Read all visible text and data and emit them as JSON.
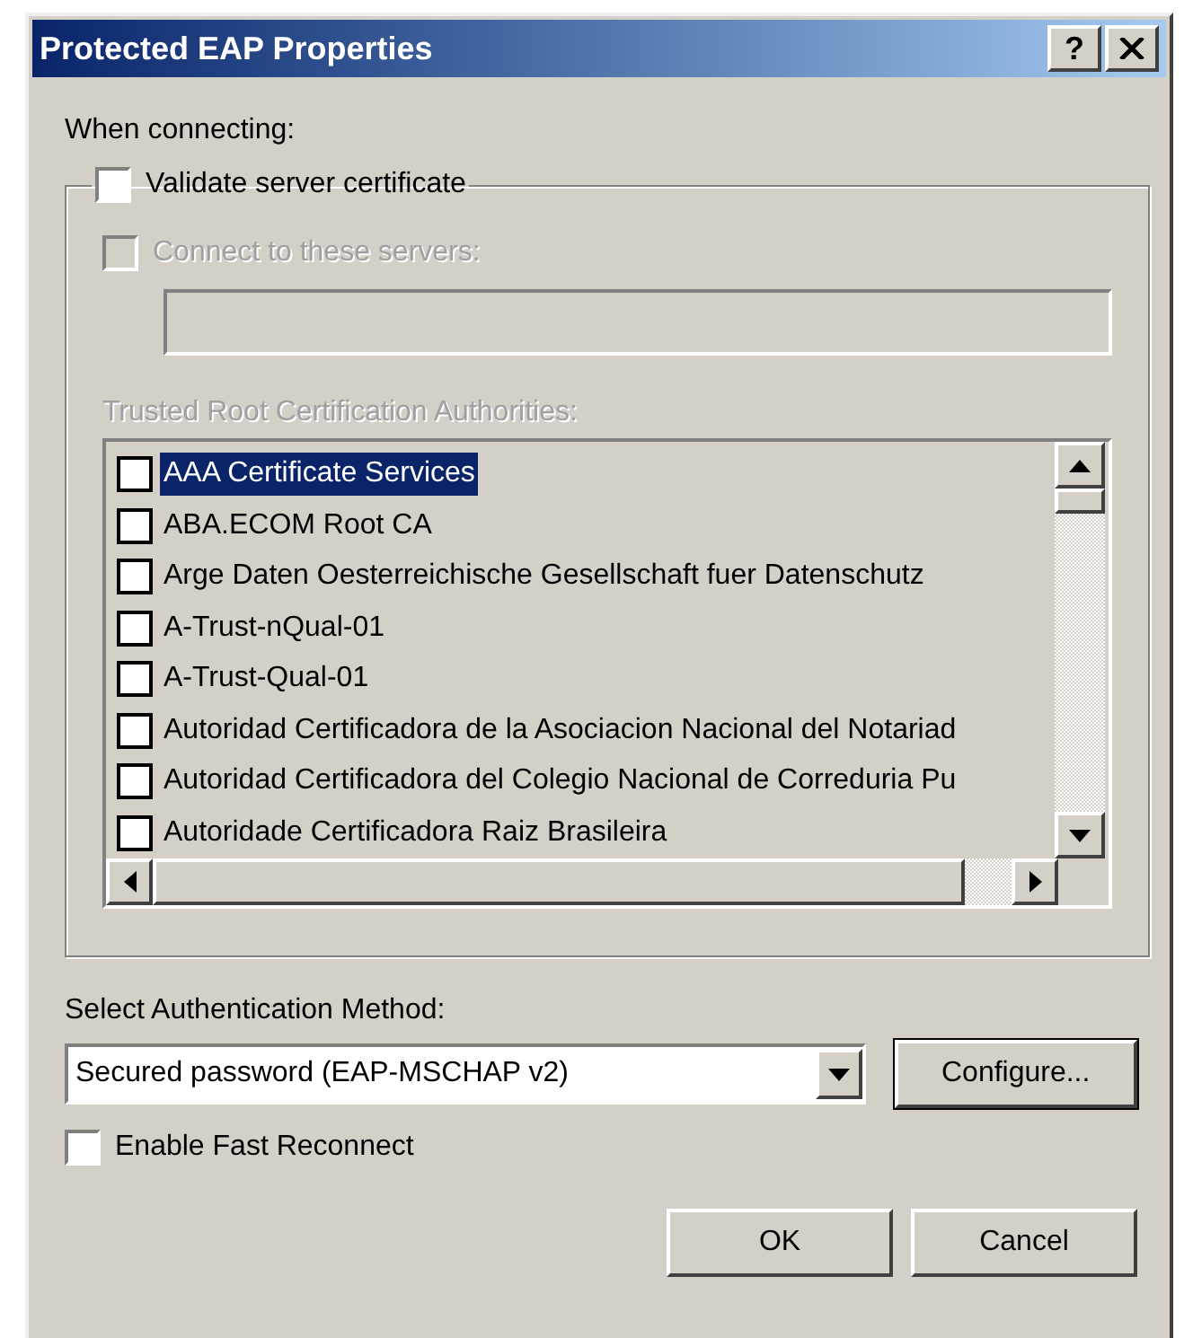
{
  "window": {
    "title": "Protected EAP Properties",
    "help_button": "?"
  },
  "when_connecting_label": "When connecting:",
  "validate_server_certificate": {
    "label": "Validate server certificate",
    "checked": false
  },
  "connect_to_servers": {
    "label": "Connect to these servers:",
    "checked": false,
    "disabled": true
  },
  "trusted_roots": {
    "label": "Trusted Root Certification Authorities:",
    "disabled": true,
    "items": [
      {
        "label": "AAA Certificate Services",
        "checked": false,
        "selected": true
      },
      {
        "label": "ABA.ECOM Root CA",
        "checked": false,
        "selected": false
      },
      {
        "label": "Arge Daten Oesterreichische Gesellschaft fuer Datenschutz",
        "checked": false,
        "selected": false
      },
      {
        "label": "A-Trust-nQual-01",
        "checked": false,
        "selected": false
      },
      {
        "label": "A-Trust-Qual-01",
        "checked": false,
        "selected": false
      },
      {
        "label": "Autoridad Certificadora de la Asociacion Nacional del Notariad",
        "checked": false,
        "selected": false
      },
      {
        "label": "Autoridad Certificadora del Colegio Nacional de Correduria Pu",
        "checked": false,
        "selected": false
      },
      {
        "label": "Autoridade Certificadora Raiz Brasileira",
        "checked": false,
        "selected": false
      }
    ]
  },
  "auth_method": {
    "label": "Select Authentication Method:",
    "value": "Secured password (EAP-MSCHAP v2)"
  },
  "configure_button": "Configure...",
  "enable_fast_reconnect": {
    "label": "Enable Fast Reconnect",
    "checked": false
  },
  "buttons": [
    "OK",
    "Cancel"
  ]
}
